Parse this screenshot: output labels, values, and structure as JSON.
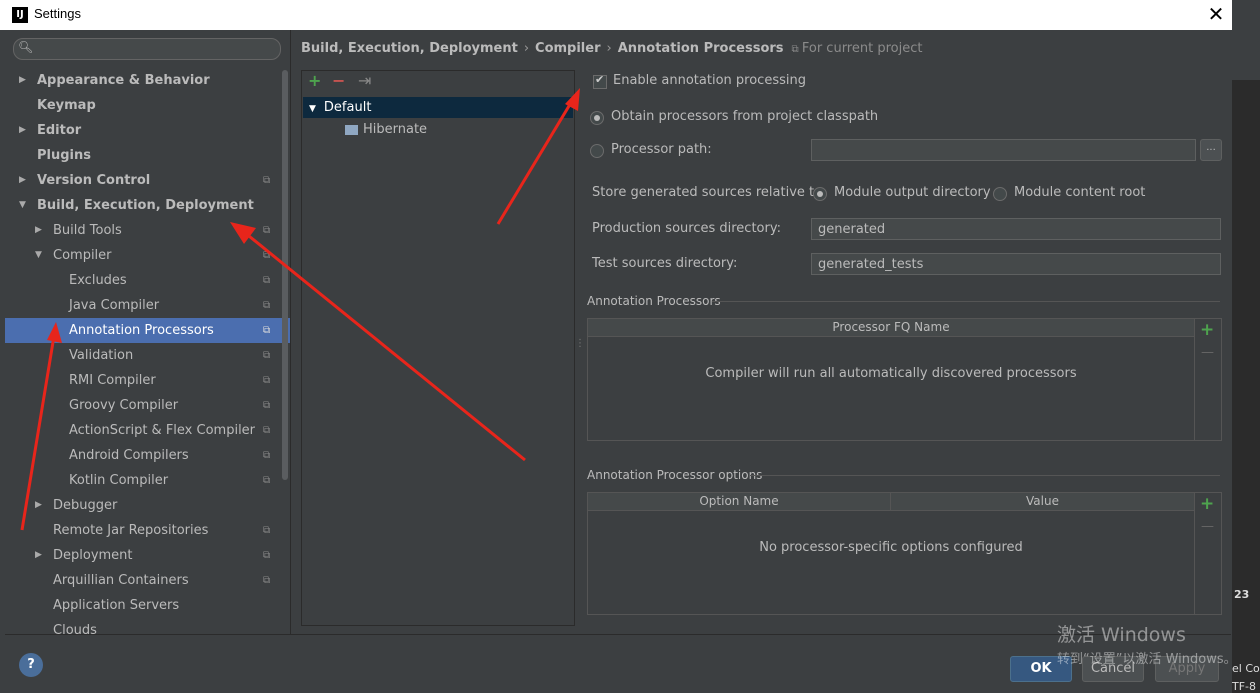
{
  "window": {
    "title": "Settings",
    "close": "✕",
    "logo": "IJ"
  },
  "search": {
    "icon": "search-icon",
    "placeholder": ""
  },
  "tree": [
    {
      "label": "Appearance & Behavior",
      "level": 0,
      "arrow": "▶",
      "bold": true,
      "copy": false
    },
    {
      "label": "Keymap",
      "level": 0,
      "arrow": "",
      "bold": true,
      "copy": false
    },
    {
      "label": "Editor",
      "level": 0,
      "arrow": "▶",
      "bold": true,
      "copy": false
    },
    {
      "label": "Plugins",
      "level": 0,
      "arrow": "",
      "bold": true,
      "copy": false
    },
    {
      "label": "Version Control",
      "level": 0,
      "arrow": "▶",
      "bold": true,
      "copy": true
    },
    {
      "label": "Build, Execution, Deployment",
      "level": 0,
      "arrow": "▼",
      "bold": true,
      "copy": false
    },
    {
      "label": "Build Tools",
      "level": 1,
      "arrow": "▶",
      "bold": false,
      "copy": true
    },
    {
      "label": "Compiler",
      "level": 1,
      "arrow": "▼",
      "bold": false,
      "copy": true
    },
    {
      "label": "Excludes",
      "level": 2,
      "arrow": "",
      "bold": false,
      "copy": true
    },
    {
      "label": "Java Compiler",
      "level": 2,
      "arrow": "",
      "bold": false,
      "copy": true
    },
    {
      "label": "Annotation Processors",
      "level": 2,
      "arrow": "",
      "bold": false,
      "copy": true,
      "selected": true
    },
    {
      "label": "Validation",
      "level": 2,
      "arrow": "",
      "bold": false,
      "copy": true
    },
    {
      "label": "RMI Compiler",
      "level": 2,
      "arrow": "",
      "bold": false,
      "copy": true
    },
    {
      "label": "Groovy Compiler",
      "level": 2,
      "arrow": "",
      "bold": false,
      "copy": true
    },
    {
      "label": "ActionScript & Flex Compiler",
      "level": 2,
      "arrow": "",
      "bold": false,
      "copy": true
    },
    {
      "label": "Android Compilers",
      "level": 2,
      "arrow": "",
      "bold": false,
      "copy": true
    },
    {
      "label": "Kotlin Compiler",
      "level": 2,
      "arrow": "",
      "bold": false,
      "copy": true
    },
    {
      "label": "Debugger",
      "level": 1,
      "arrow": "▶",
      "bold": false,
      "copy": false
    },
    {
      "label": "Remote Jar Repositories",
      "level": 1,
      "arrow": "",
      "bold": false,
      "copy": true
    },
    {
      "label": "Deployment",
      "level": 1,
      "arrow": "▶",
      "bold": false,
      "copy": true
    },
    {
      "label": "Arquillian Containers",
      "level": 1,
      "arrow": "",
      "bold": false,
      "copy": true
    },
    {
      "label": "Application Servers",
      "level": 1,
      "arrow": "",
      "bold": false,
      "copy": false
    },
    {
      "label": "Clouds",
      "level": 1,
      "arrow": "",
      "bold": false,
      "copy": false
    }
  ],
  "breadcrumb": {
    "parts": [
      "Build, Execution, Deployment",
      "Compiler",
      "Annotation Processors"
    ],
    "separator": "›",
    "project_scope": "For current project"
  },
  "profiles": {
    "add": "+",
    "remove": "−",
    "move": "⇥",
    "default_label": "Default",
    "child_label": "Hibernate"
  },
  "options": {
    "enable_label": "Enable annotation processing",
    "enable_checked": true,
    "obtain_label": "Obtain processors from project classpath",
    "path_label": "Processor path:",
    "path_value": "",
    "browse": "...",
    "store_label": "Store generated sources relative to:",
    "store_opt1": "Module output directory",
    "store_opt2": "Module content root",
    "prod_label": "Production sources directory:",
    "prod_value": "generated",
    "test_label": "Test sources directory:",
    "test_value": "generated_tests"
  },
  "processors_section": {
    "title": "Annotation Processors",
    "column": "Processor FQ Name",
    "empty": "Compiler will run all automatically discovered processors",
    "add": "+",
    "remove": "—"
  },
  "options_section": {
    "title": "Annotation Processor options",
    "col1": "Option Name",
    "col2": "Value",
    "empty": "No processor-specific options configured",
    "add": "+",
    "remove": "—"
  },
  "buttons": {
    "help": "?",
    "ok": "OK",
    "cancel": "Cancel",
    "apply": "Apply"
  },
  "watermark": {
    "line1": "激活 Windows",
    "line2": "转到“设置”以激活 Windows。"
  },
  "background_app": {
    "t1": "23",
    "t2": "el Co",
    "t3": "TF-8"
  },
  "colors": {
    "selection": "#4b6eaf",
    "accent_add": "#4ea34e",
    "accent_remove": "#c75450",
    "arrow_annotation": "#e8251b"
  }
}
